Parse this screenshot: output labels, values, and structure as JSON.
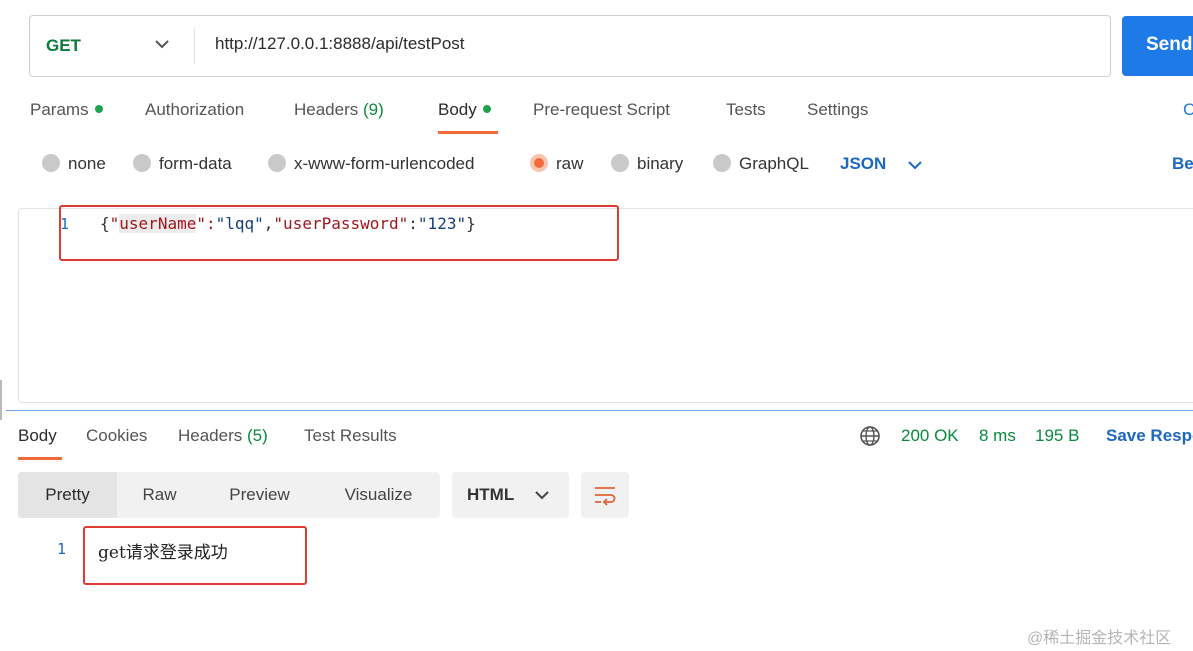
{
  "request": {
    "method": "GET",
    "url": "http://127.0.0.1:8888/api/testPost",
    "send_label": "Send"
  },
  "request_tabs": {
    "params": "Params",
    "authorization": "Authorization",
    "headers": "Headers",
    "headers_count": "(9)",
    "body": "Body",
    "pre_request": "Pre-request Script",
    "tests": "Tests",
    "settings": "Settings",
    "cookies": "Cookies"
  },
  "body_types": {
    "none": "none",
    "form_data": "form-data",
    "urlencoded": "x-www-form-urlencoded",
    "raw": "raw",
    "binary": "binary",
    "graphql": "GraphQL",
    "selected": "raw",
    "format": "JSON",
    "beautify": "Beautify"
  },
  "editor": {
    "line_number": "1",
    "tokens": {
      "brace_open": "{",
      "q1": "\"",
      "key1": "userName",
      "sep1": "\":",
      "val1": "\"lqq\"",
      "comma": ",",
      "key2": "\"userPassword\"",
      "colon": ":",
      "val2": "\"123\"",
      "brace_close": "}"
    }
  },
  "response_tabs": {
    "body": "Body",
    "cookies": "Cookies",
    "headers": "Headers",
    "headers_count": "(5)",
    "test_results": "Test Results"
  },
  "response_status": {
    "code": "200 OK",
    "time": "8 ms",
    "size": "195 B",
    "save_label": "Save Response"
  },
  "response_view": {
    "pretty": "Pretty",
    "raw": "Raw",
    "preview": "Preview",
    "visualize": "Visualize",
    "format": "HTML"
  },
  "response_body": {
    "line_number": "1",
    "text": "get请求登录成功"
  },
  "watermark": "@稀土掘金技术社区",
  "colors": {
    "accent_orange": "#f26b3a",
    "send_blue": "#1d7ae6",
    "link_blue": "#1d68c2",
    "success_green": "#0b8a3e",
    "annotation_red": "#e03a35"
  }
}
